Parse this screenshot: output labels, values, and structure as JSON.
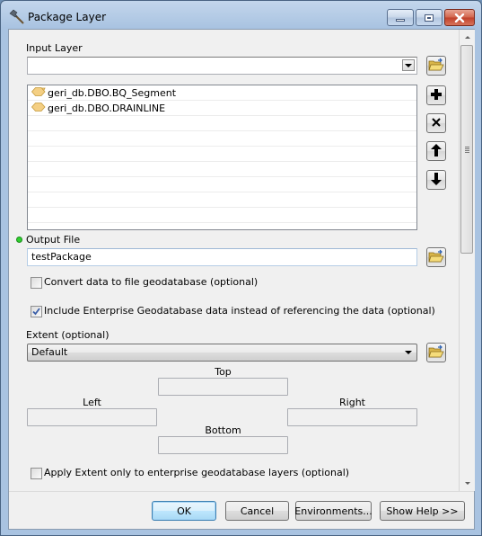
{
  "window": {
    "title": "Package Layer",
    "icon": "hammer-icon",
    "controls": [
      "minimize",
      "maximize",
      "close"
    ]
  },
  "form": {
    "input_layer": {
      "label": "Input Layer",
      "value": "",
      "browse_icon": "folder-open-icon"
    },
    "layer_list": {
      "items": [
        {
          "name": "geri_db.DBO.BQ_Segment",
          "icon": "feature-layer-icon"
        },
        {
          "name": "geri_db.DBO.DRAINLINE",
          "icon": "feature-layer-icon"
        }
      ],
      "empty_rows": 7,
      "actions": [
        {
          "name": "add",
          "icon": "plus-icon"
        },
        {
          "name": "remove",
          "icon": "x-icon"
        },
        {
          "name": "move-up",
          "icon": "arrow-up-icon"
        },
        {
          "name": "move-down",
          "icon": "arrow-down-icon"
        }
      ]
    },
    "output_file": {
      "label": "Output File",
      "value": "testPackage",
      "required": true,
      "browse_icon": "folder-open-icon"
    },
    "convert_to_fgdb": {
      "label": "Convert data to file geodatabase (optional)",
      "checked": false
    },
    "include_enterprise": {
      "label": "Include Enterprise Geodatabase data instead of referencing the data (optional)",
      "checked": true
    },
    "extent": {
      "label": "Extent (optional)",
      "selected": "Default",
      "top_label": "Top",
      "left_label": "Left",
      "right_label": "Right",
      "bottom_label": "Bottom",
      "top_value": "",
      "left_value": "",
      "right_value": "",
      "bottom_value": ""
    },
    "apply_extent_only": {
      "label": "Apply Extent only to enterprise geodatabase layers (optional)",
      "checked": false
    }
  },
  "footer": {
    "ok": "OK",
    "cancel": "Cancel",
    "environments": "Environments...",
    "show_help": "Show Help >>"
  }
}
